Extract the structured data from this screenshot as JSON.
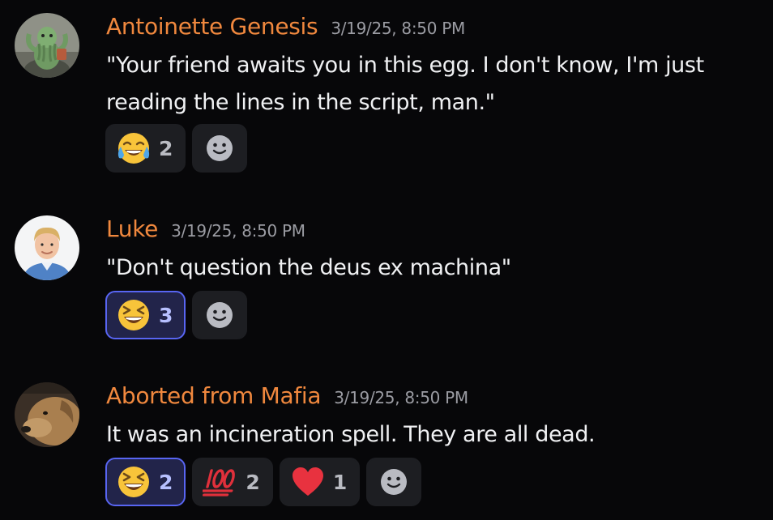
{
  "messages": [
    {
      "username": "Antoinette Genesis",
      "timestamp": "3/19/25, 8:50 PM",
      "lines": [
        "\"Your friend awaits you in this egg. I don't know, I'm just",
        "reading the lines in the script, man.\""
      ],
      "avatar_icon": "cthulhu-avatar",
      "reactions": [
        {
          "emoji": "joy-emoji",
          "count": "2",
          "active": false
        }
      ]
    },
    {
      "username": "Luke",
      "timestamp": "3/19/25, 8:50 PM",
      "lines": [
        "\"Don't question the deus ex machina\""
      ],
      "avatar_icon": "person-photo-avatar",
      "reactions": [
        {
          "emoji": "laughing-emoji",
          "count": "3",
          "active": true
        }
      ]
    },
    {
      "username": "Aborted from Mafia",
      "timestamp": "3/19/25, 8:50 PM",
      "lines": [
        "It was an incineration spell. They are all dead."
      ],
      "avatar_icon": "dog-photo-avatar",
      "reactions": [
        {
          "emoji": "laughing-emoji",
          "count": "2",
          "active": true
        },
        {
          "emoji": "hundred-points-emoji",
          "count": "2",
          "active": false
        },
        {
          "emoji": "red-heart-emoji",
          "count": "1",
          "active": false
        }
      ]
    }
  ],
  "colors": {
    "background": "#070709",
    "username": "#f0883e",
    "timestamp": "#9b9ca3",
    "text": "#f0f1f3",
    "reaction_bg": "#1d1e22",
    "reaction_active_bg": "#22244a",
    "reaction_active_border": "#5865f2"
  }
}
